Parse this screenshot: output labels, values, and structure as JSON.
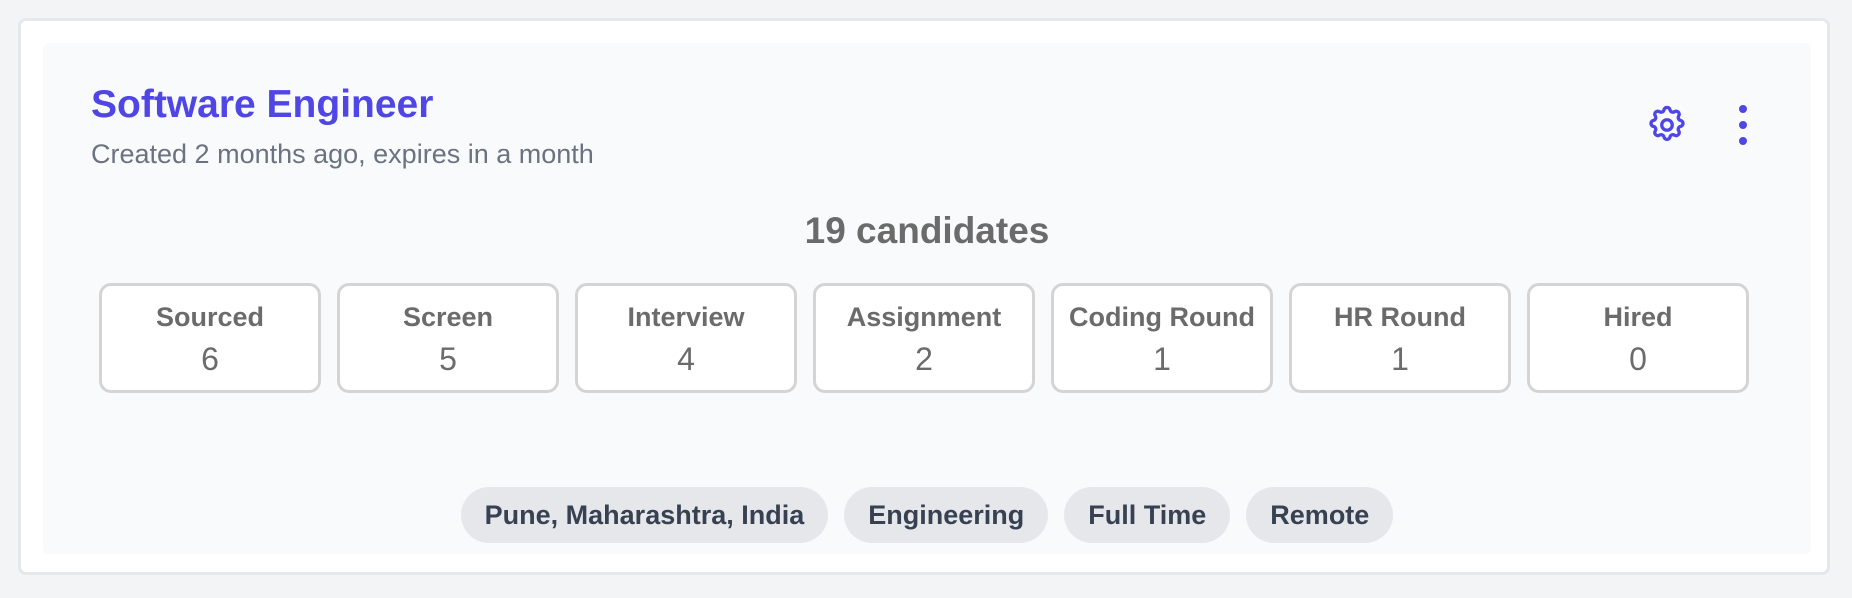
{
  "job": {
    "title": "Software Engineer",
    "subtitle": "Created 2 months ago, expires in a month",
    "candidate_count": "19 candidates"
  },
  "actions": {
    "settings_icon": "gear-icon",
    "more_icon": "vertical-dots-icon"
  },
  "stages": [
    {
      "label": "Sourced",
      "value": "6"
    },
    {
      "label": "Screen",
      "value": "5"
    },
    {
      "label": "Interview",
      "value": "4"
    },
    {
      "label": "Assignment",
      "value": "2"
    },
    {
      "label": "Coding Round",
      "value": "1"
    },
    {
      "label": "HR Round",
      "value": "1"
    },
    {
      "label": "Hired",
      "value": "0"
    }
  ],
  "tags": [
    "Pune, Maharashtra, India",
    "Engineering",
    "Full Time",
    "Remote"
  ],
  "colors": {
    "accent": "#4f46e5",
    "muted_text": "#6b7280",
    "stage_text": "#6b6b6b",
    "tag_bg": "#e5e7eb",
    "tag_text": "#374151"
  }
}
